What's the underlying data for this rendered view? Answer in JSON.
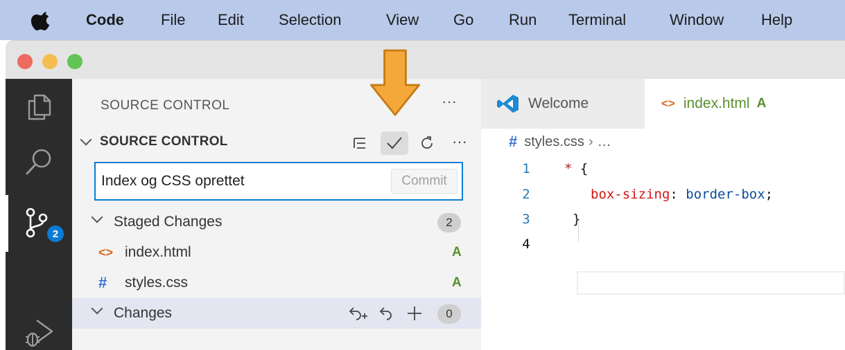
{
  "menubar": {
    "items": [
      {
        "label": "Code",
        "bold": true
      },
      {
        "label": "File"
      },
      {
        "label": "Edit"
      },
      {
        "label": "Selection"
      },
      {
        "label": "View"
      },
      {
        "label": "Go"
      },
      {
        "label": "Run"
      },
      {
        "label": "Terminal"
      },
      {
        "label": "Window"
      },
      {
        "label": "Help"
      }
    ]
  },
  "activity_bar": {
    "scm_badge": "2"
  },
  "sidebar": {
    "title": "SOURCE CONTROL",
    "title_more": "···",
    "section_title": "SOURCE CONTROL",
    "toolbar_more": "···",
    "commit_message": "Index og CSS oprettet",
    "commit_button": "Commit",
    "staged": {
      "label": "Staged Changes",
      "count": "2",
      "files": [
        {
          "name": "index.html",
          "status": "A",
          "icon": "html-icon",
          "glyph": "<>"
        },
        {
          "name": "styles.css",
          "status": "A",
          "icon": "css-icon",
          "glyph": "#"
        }
      ]
    },
    "changes": {
      "label": "Changes",
      "count": "0"
    }
  },
  "editor": {
    "tabs": [
      {
        "label": "Welcome"
      },
      {
        "label": "index.html",
        "status": "A"
      }
    ],
    "breadcrumb": {
      "glyph": "#",
      "file": "styles.css",
      "rest": "…"
    },
    "lines": [
      {
        "num": "1"
      },
      {
        "num": "2"
      },
      {
        "num": "3"
      },
      {
        "num": "4"
      }
    ],
    "code": {
      "l1_selector": "*",
      "l1_brace": " {",
      "l2_prop": "box-sizing",
      "l2_colon": ": ",
      "l2_value": "border-box",
      "l2_semi": ";",
      "l3_brace": "}"
    }
  },
  "colors": {
    "accent": "#0a7bd3",
    "added": "#5a8f2f",
    "arrow": "#f5a83a",
    "menubar": "#b9c9ea",
    "activity_bar": "#2c2c2c"
  }
}
